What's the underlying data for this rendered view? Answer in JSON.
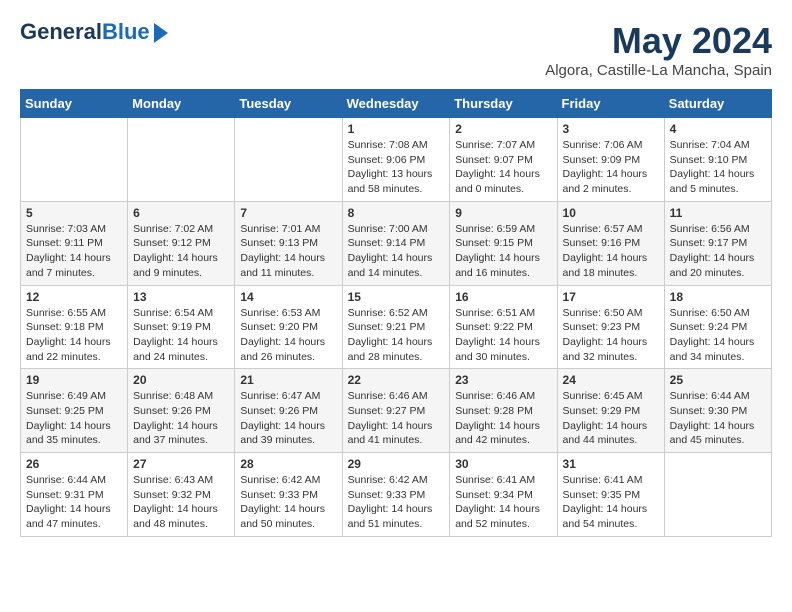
{
  "logo": {
    "line1": "General",
    "line2": "Blue",
    "arrow": true
  },
  "title": "May 2024",
  "location": "Algora, Castille-La Mancha, Spain",
  "headers": [
    "Sunday",
    "Monday",
    "Tuesday",
    "Wednesday",
    "Thursday",
    "Friday",
    "Saturday"
  ],
  "weeks": [
    [
      {
        "day": "",
        "info": ""
      },
      {
        "day": "",
        "info": ""
      },
      {
        "day": "",
        "info": ""
      },
      {
        "day": "1",
        "info": "Sunrise: 7:08 AM\nSunset: 9:06 PM\nDaylight: 13 hours\nand 58 minutes."
      },
      {
        "day": "2",
        "info": "Sunrise: 7:07 AM\nSunset: 9:07 PM\nDaylight: 14 hours\nand 0 minutes."
      },
      {
        "day": "3",
        "info": "Sunrise: 7:06 AM\nSunset: 9:09 PM\nDaylight: 14 hours\nand 2 minutes."
      },
      {
        "day": "4",
        "info": "Sunrise: 7:04 AM\nSunset: 9:10 PM\nDaylight: 14 hours\nand 5 minutes."
      }
    ],
    [
      {
        "day": "5",
        "info": "Sunrise: 7:03 AM\nSunset: 9:11 PM\nDaylight: 14 hours\nand 7 minutes."
      },
      {
        "day": "6",
        "info": "Sunrise: 7:02 AM\nSunset: 9:12 PM\nDaylight: 14 hours\nand 9 minutes."
      },
      {
        "day": "7",
        "info": "Sunrise: 7:01 AM\nSunset: 9:13 PM\nDaylight: 14 hours\nand 11 minutes."
      },
      {
        "day": "8",
        "info": "Sunrise: 7:00 AM\nSunset: 9:14 PM\nDaylight: 14 hours\nand 14 minutes."
      },
      {
        "day": "9",
        "info": "Sunrise: 6:59 AM\nSunset: 9:15 PM\nDaylight: 14 hours\nand 16 minutes."
      },
      {
        "day": "10",
        "info": "Sunrise: 6:57 AM\nSunset: 9:16 PM\nDaylight: 14 hours\nand 18 minutes."
      },
      {
        "day": "11",
        "info": "Sunrise: 6:56 AM\nSunset: 9:17 PM\nDaylight: 14 hours\nand 20 minutes."
      }
    ],
    [
      {
        "day": "12",
        "info": "Sunrise: 6:55 AM\nSunset: 9:18 PM\nDaylight: 14 hours\nand 22 minutes."
      },
      {
        "day": "13",
        "info": "Sunrise: 6:54 AM\nSunset: 9:19 PM\nDaylight: 14 hours\nand 24 minutes."
      },
      {
        "day": "14",
        "info": "Sunrise: 6:53 AM\nSunset: 9:20 PM\nDaylight: 14 hours\nand 26 minutes."
      },
      {
        "day": "15",
        "info": "Sunrise: 6:52 AM\nSunset: 9:21 PM\nDaylight: 14 hours\nand 28 minutes."
      },
      {
        "day": "16",
        "info": "Sunrise: 6:51 AM\nSunset: 9:22 PM\nDaylight: 14 hours\nand 30 minutes."
      },
      {
        "day": "17",
        "info": "Sunrise: 6:50 AM\nSunset: 9:23 PM\nDaylight: 14 hours\nand 32 minutes."
      },
      {
        "day": "18",
        "info": "Sunrise: 6:50 AM\nSunset: 9:24 PM\nDaylight: 14 hours\nand 34 minutes."
      }
    ],
    [
      {
        "day": "19",
        "info": "Sunrise: 6:49 AM\nSunset: 9:25 PM\nDaylight: 14 hours\nand 35 minutes."
      },
      {
        "day": "20",
        "info": "Sunrise: 6:48 AM\nSunset: 9:26 PM\nDaylight: 14 hours\nand 37 minutes."
      },
      {
        "day": "21",
        "info": "Sunrise: 6:47 AM\nSunset: 9:26 PM\nDaylight: 14 hours\nand 39 minutes."
      },
      {
        "day": "22",
        "info": "Sunrise: 6:46 AM\nSunset: 9:27 PM\nDaylight: 14 hours\nand 41 minutes."
      },
      {
        "day": "23",
        "info": "Sunrise: 6:46 AM\nSunset: 9:28 PM\nDaylight: 14 hours\nand 42 minutes."
      },
      {
        "day": "24",
        "info": "Sunrise: 6:45 AM\nSunset: 9:29 PM\nDaylight: 14 hours\nand 44 minutes."
      },
      {
        "day": "25",
        "info": "Sunrise: 6:44 AM\nSunset: 9:30 PM\nDaylight: 14 hours\nand 45 minutes."
      }
    ],
    [
      {
        "day": "26",
        "info": "Sunrise: 6:44 AM\nSunset: 9:31 PM\nDaylight: 14 hours\nand 47 minutes."
      },
      {
        "day": "27",
        "info": "Sunrise: 6:43 AM\nSunset: 9:32 PM\nDaylight: 14 hours\nand 48 minutes."
      },
      {
        "day": "28",
        "info": "Sunrise: 6:42 AM\nSunset: 9:33 PM\nDaylight: 14 hours\nand 50 minutes."
      },
      {
        "day": "29",
        "info": "Sunrise: 6:42 AM\nSunset: 9:33 PM\nDaylight: 14 hours\nand 51 minutes."
      },
      {
        "day": "30",
        "info": "Sunrise: 6:41 AM\nSunset: 9:34 PM\nDaylight: 14 hours\nand 52 minutes."
      },
      {
        "day": "31",
        "info": "Sunrise: 6:41 AM\nSunset: 9:35 PM\nDaylight: 14 hours\nand 54 minutes."
      },
      {
        "day": "",
        "info": ""
      }
    ]
  ]
}
